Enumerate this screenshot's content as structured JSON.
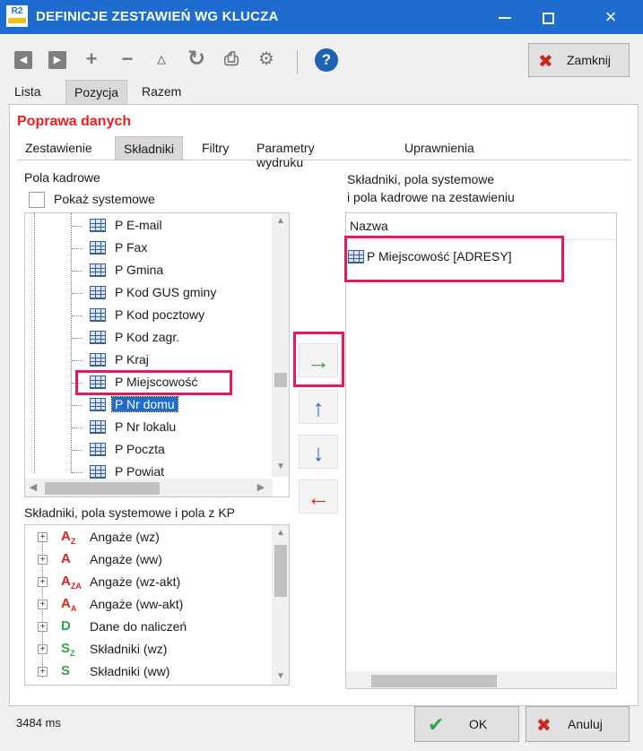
{
  "window": {
    "title": "DEFINICJE ZESTAWIEŃ WG KLUCZA",
    "app_icon": "R2",
    "minimize_icon": "minimize-icon",
    "maximize_icon": "maximize-icon",
    "close_icon": "×"
  },
  "toolbar": {
    "close_label": "Zamknij",
    "icons": [
      "prev-icon",
      "next-icon",
      "add-icon",
      "remove-icon",
      "edit-icon",
      "refresh-icon",
      "print-icon",
      "settings-icon",
      "help-icon"
    ]
  },
  "outer_tabs": [
    "Lista",
    "Pozycja",
    "Razem"
  ],
  "section_title": "Poprawa danych",
  "inner_tabs": [
    "Zestawienie",
    "Składniki",
    "Filtry",
    "Parametry wydruku",
    "Uprawnienia"
  ],
  "left": {
    "fields_label": "Pola kadrowe",
    "show_system_label": "Pokaż systemowe",
    "fields": [
      "P E-mail",
      "P Fax",
      "P Gmina",
      "P Kod GUS gminy",
      "P Kod pocztowy",
      "P Kod zagr.",
      "P Kraj",
      "P Miejscowość",
      "P Nr domu",
      "P Nr lokalu",
      "P Poczta",
      "P Powiat"
    ],
    "selected_index": 8,
    "highlighted_index": 7
  },
  "kp": {
    "label": "Składniki, pola systemowe i pola z KP",
    "items": [
      {
        "icon": "A",
        "sub": "Z",
        "text": "Angaże (wz)",
        "color": "#d2261d"
      },
      {
        "icon": "A",
        "sub": "",
        "text": "Angaże (ww)",
        "color": "#d2261d"
      },
      {
        "icon": "A",
        "sub": "ZA",
        "text": "Angaże (wz-akt)",
        "color": "#d2261d"
      },
      {
        "icon": "A",
        "sub": "A",
        "text": "Angaże (ww-akt)",
        "color": "#d2261d"
      },
      {
        "icon": "D",
        "sub": "",
        "text": "Dane do naliczeń",
        "color": "#39a34a"
      },
      {
        "icon": "S",
        "sub": "Z",
        "text": "Składniki (wz)",
        "color": "#39a34a"
      },
      {
        "icon": "S",
        "sub": "",
        "text": "Składniki (ww)",
        "color": "#39a34a"
      }
    ]
  },
  "right": {
    "label_line1": "Składniki, pola systemowe",
    "label_line2": "i pola kadrowe na zestawieniu",
    "column_header": "Nazwa",
    "items": [
      "P Miejscowość [ADRESY]"
    ]
  },
  "mid_buttons": {
    "add": "→",
    "up": "↑",
    "down": "↓",
    "remove": "←"
  },
  "footer": {
    "status": "3484 ms",
    "ok_label": "OK",
    "cancel_label": "Anuluj"
  },
  "colors": {
    "title_bar": "#1e6ccf",
    "section_title": "#e8201f",
    "highlight": "#e8195a",
    "selection": "#1e6ccf"
  }
}
